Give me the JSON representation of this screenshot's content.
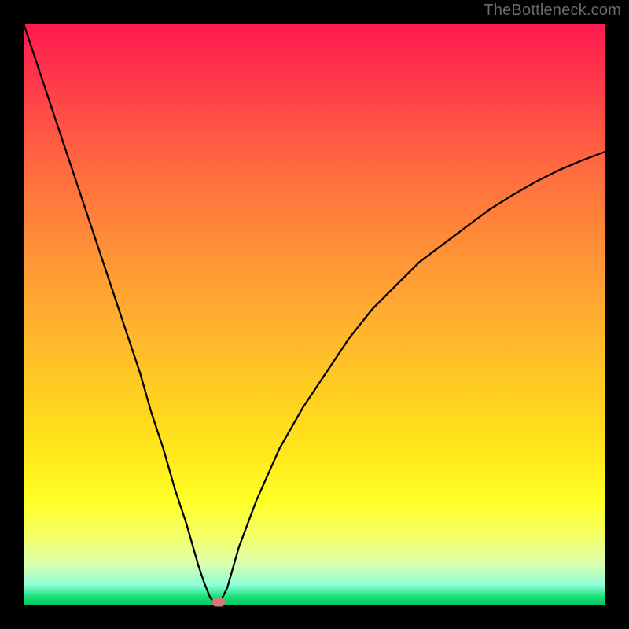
{
  "watermark": "TheBottleneck.com",
  "colors": {
    "frame": "#000000",
    "curve": "#000000",
    "marker": "#cf7a7a",
    "watermark_text": "#6a6a6a"
  },
  "chart_data": {
    "type": "line",
    "title": "",
    "xlabel": "",
    "ylabel": "",
    "xlim": [
      0,
      100
    ],
    "ylim": [
      0,
      100
    ],
    "grid": false,
    "legend": false,
    "annotations": [
      "TheBottleneck.com"
    ],
    "gradient_background": {
      "direction": "vertical",
      "stops": [
        {
          "pos": 0,
          "color": "#ff1a4f"
        },
        {
          "pos": 25,
          "color": "#ff6a3f"
        },
        {
          "pos": 52,
          "color": "#ffb22f"
        },
        {
          "pos": 74,
          "color": "#ffe81a"
        },
        {
          "pos": 93,
          "color": "#d9ffb0"
        },
        {
          "pos": 100,
          "color": "#05c562"
        }
      ]
    },
    "curve_description": "V-shaped bottleneck curve. Left branch drops steeply from (0,100) to the minimum; right branch rises concavely toward (100,~78). Minimum value 0 at x≈33.",
    "x": [
      0,
      2,
      4,
      6,
      8,
      10,
      12,
      14,
      16,
      18,
      20,
      22,
      24,
      26,
      28,
      30,
      31,
      32,
      33,
      34,
      35,
      37,
      40,
      44,
      48,
      52,
      56,
      60,
      64,
      68,
      72,
      76,
      80,
      84,
      88,
      92,
      96,
      100
    ],
    "y": [
      100,
      94,
      88,
      82,
      76,
      70,
      64,
      58,
      52,
      46,
      40,
      33,
      27,
      20,
      14,
      7,
      4,
      1.5,
      0,
      1,
      3,
      10,
      18,
      27,
      34,
      40,
      46,
      51,
      55,
      59,
      62,
      65,
      68,
      70.5,
      72.8,
      74.8,
      76.5,
      78
    ],
    "marker": {
      "x": 33.5,
      "y": 0.5
    }
  }
}
